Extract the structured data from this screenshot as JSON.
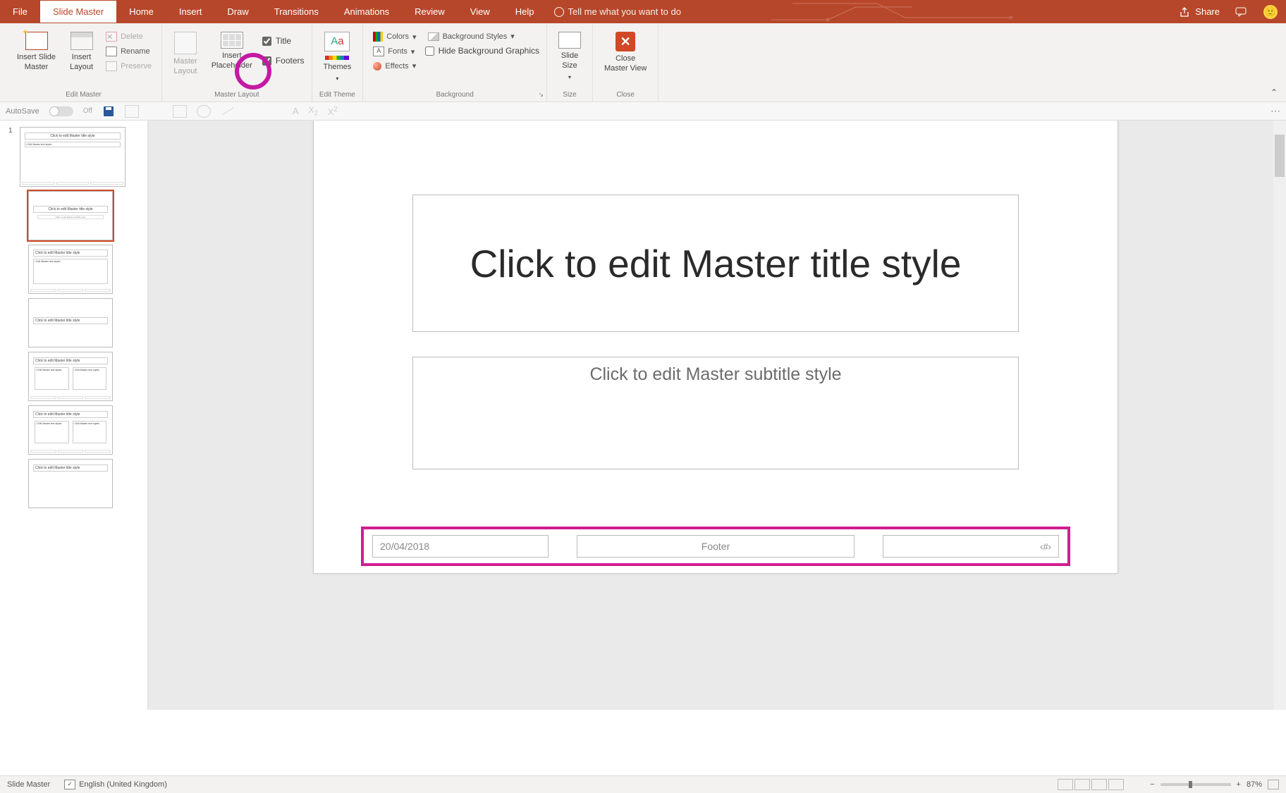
{
  "tabs": {
    "file": "File",
    "slide_master": "Slide Master",
    "home": "Home",
    "insert": "Insert",
    "draw": "Draw",
    "transitions": "Transitions",
    "animations": "Animations",
    "review": "Review",
    "view": "View",
    "help": "Help",
    "tell_me": "Tell me what you want to do",
    "share": "Share"
  },
  "ribbon": {
    "edit_master": {
      "group": "Edit Master",
      "insert_slide_master": "Insert Slide\nMaster",
      "insert_layout": "Insert\nLayout",
      "delete": "Delete",
      "rename": "Rename",
      "preserve": "Preserve"
    },
    "master_layout": {
      "group": "Master Layout",
      "master_layout_btn": "Master\nLayout",
      "insert_placeholder": "Insert\nPlaceholder",
      "title": "Title",
      "footers": "Footers"
    },
    "edit_theme": {
      "group": "Edit Theme",
      "themes": "Themes"
    },
    "background": {
      "group": "Background",
      "colors": "Colors",
      "fonts": "Fonts",
      "effects": "Effects",
      "bg_styles": "Background Styles",
      "hide_bg": "Hide Background Graphics"
    },
    "size": {
      "group": "Size",
      "slide_size": "Slide\nSize"
    },
    "close": {
      "group": "Close",
      "close_master": "Close\nMaster View"
    }
  },
  "qat": {
    "autosave": "AutoSave",
    "off": "Off"
  },
  "subscript": "X",
  "sub2": "2",
  "superscript": "X",
  "sup2": "2",
  "thumbs": {
    "master_title": "Click to edit Master title style",
    "master_body": "• Edit Master text styles",
    "layout_subtitle": "Click to edit Master subtitle style"
  },
  "slide": {
    "title": "Click to edit Master title style",
    "subtitle": "Click to edit Master subtitle style",
    "date": "20/04/2018",
    "footer": "Footer",
    "pagenum": "‹#›"
  },
  "status": {
    "view": "Slide Master",
    "lang": "English (United Kingdom)",
    "zoom": "87%"
  }
}
